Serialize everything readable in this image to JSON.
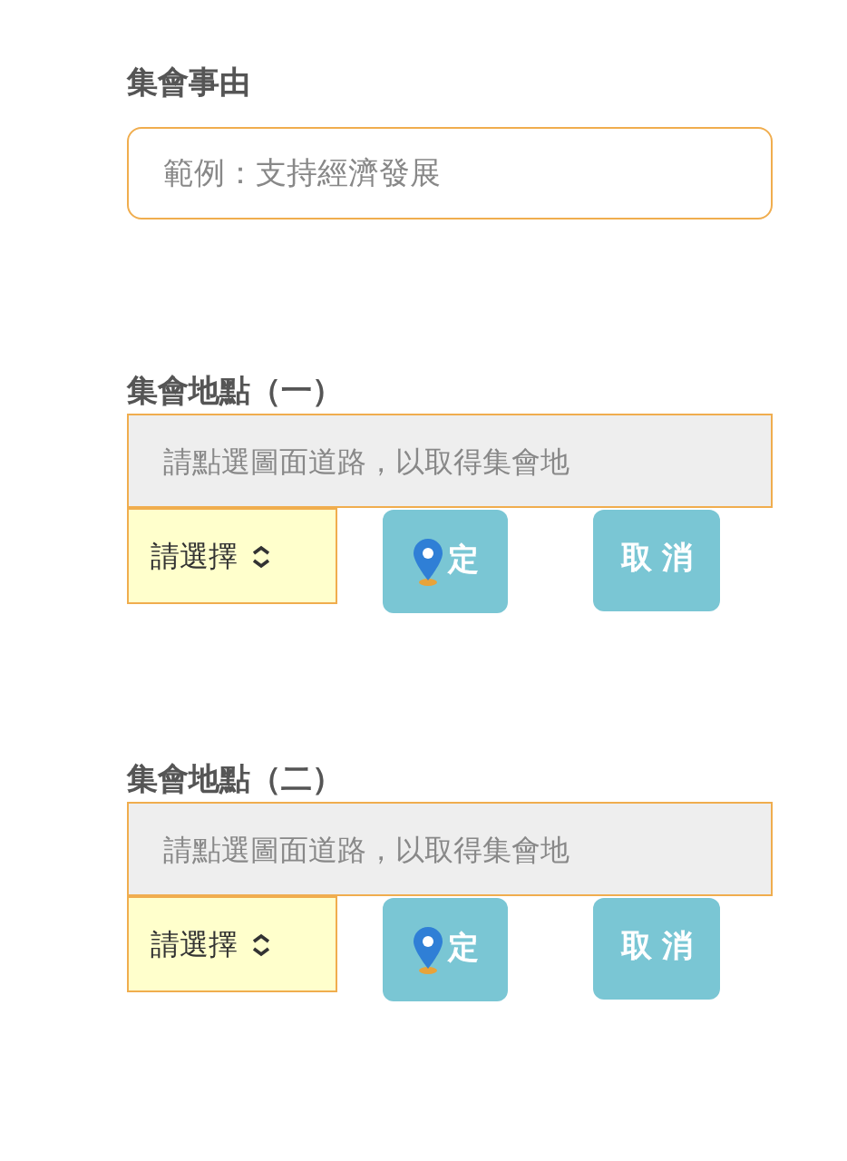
{
  "reason": {
    "label": "集會事由",
    "placeholder": "範例：支持經濟發展"
  },
  "locations": [
    {
      "label": "集會地點（一）",
      "placeholder": "請點選圖面道路，以取得集會地",
      "select": "請選擇",
      "locate_button": "定",
      "cancel_button": "取 消"
    },
    {
      "label": "集會地點（二）",
      "placeholder": "請點選圖面道路，以取得集會地",
      "select": "請選擇",
      "locate_button": "定",
      "cancel_button": "取 消"
    }
  ]
}
